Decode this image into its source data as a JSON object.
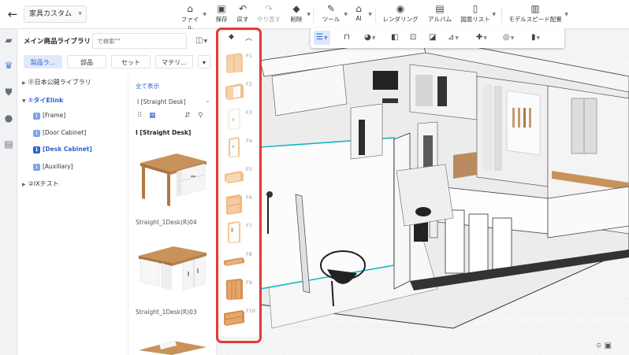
{
  "header": {
    "document_name": "家具カスタム",
    "tools": [
      {
        "label": "ファイル",
        "icon": "home-icon",
        "caret": true
      },
      {
        "label": "保存",
        "icon": "save-icon"
      },
      {
        "label": "戻す",
        "icon": "undo-icon"
      },
      {
        "label": "やり直す",
        "icon": "redo-icon",
        "disabled": true
      },
      {
        "label": "削除",
        "icon": "eraser-icon",
        "caret": true
      },
      {
        "label": "ツール",
        "icon": "wrench-icon",
        "caret": true
      },
      {
        "label": "AI",
        "icon": "ai-icon",
        "caret": true
      },
      {
        "label": "レンダリング",
        "icon": "camera-icon"
      },
      {
        "label": "アルバム",
        "icon": "album-icon"
      },
      {
        "label": "図面リスト",
        "icon": "document-icon",
        "caret": true
      },
      {
        "label": "モデルスピード配置",
        "icon": "speed-layout-icon",
        "caret": true
      }
    ]
  },
  "library": {
    "title": "メイン商品ライブラリ",
    "search_placeholder": "で検索\"\"",
    "tabs": [
      "製品ラ...",
      "部品",
      "セット",
      "マテリ..."
    ],
    "active_tab": 0,
    "tree": [
      {
        "label": "⓪日本公開ライブラリ",
        "expanded": false
      },
      {
        "label": "①タイElink",
        "expanded": true,
        "selected": true,
        "children": [
          "[Frame]",
          "[Door Cabinet]",
          "[Desk Cabinet]",
          "[Auxiliary]"
        ],
        "selected_child": 2
      },
      {
        "label": "②IXテスト",
        "expanded": false
      }
    ],
    "show_all": "全て表示",
    "category_filter": "Ⅰ [Straight Desk]",
    "section_title": "Ⅰ [Straight Desk]",
    "products": [
      "Straight_1Desk(R)04",
      "Straight_1Desk(R)03"
    ]
  },
  "floor_selector": {
    "floors": [
      "F1",
      "F2",
      "F3",
      "F4",
      "F5",
      "F6",
      "F7",
      "F8",
      "F9",
      "F10"
    ]
  },
  "colors": {
    "accent": "#2e63d6",
    "highlight": "#e53935",
    "teal": "#15b5c4"
  }
}
